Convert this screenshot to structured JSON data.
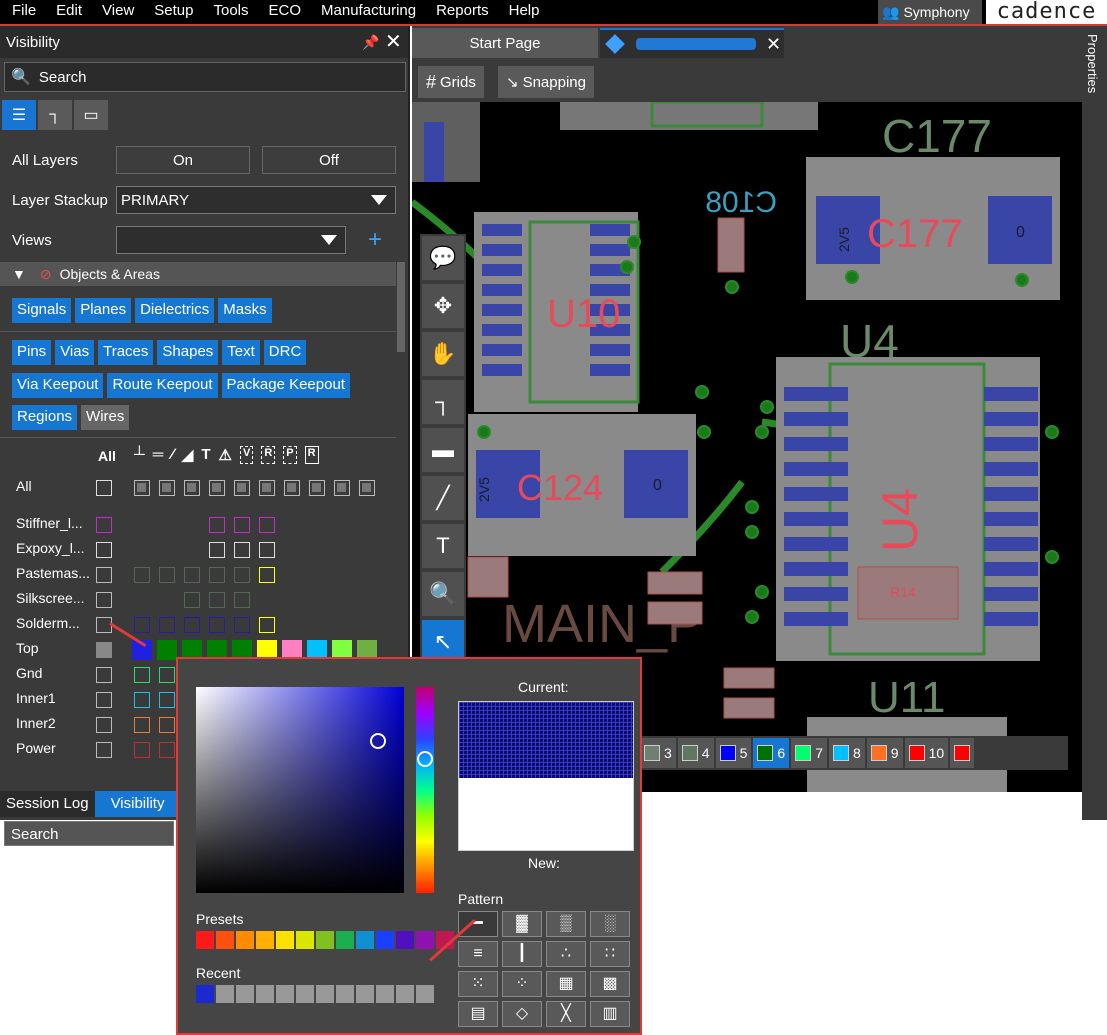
{
  "menubar": {
    "items": [
      "File",
      "Edit",
      "View",
      "Setup",
      "Tools",
      "ECO",
      "Manufacturing",
      "Reports",
      "Help"
    ],
    "symphony": "Symphony",
    "brand": "cadence"
  },
  "visibility": {
    "title": "Visibility",
    "search": "Search",
    "all_layers_label": "All Layers",
    "on_label": "On",
    "off_label": "Off",
    "stackup_label": "Layer Stackup",
    "stackup_value": "PRIMARY",
    "views_label": "Views",
    "views_value": "",
    "objects_header": "Objects & Areas",
    "chips_row1": [
      "Signals",
      "Planes",
      "Dielectrics",
      "Masks"
    ],
    "chips_row2": [
      "Pins",
      "Vias",
      "Traces",
      "Shapes",
      "Text",
      "DRC"
    ],
    "chips_row3": [
      "Via Keepout",
      "Route Keepout",
      "Package Keepout"
    ],
    "chips_row4": [
      "Regions",
      "Wires"
    ],
    "grid_all_header": "All",
    "grid_badges": [
      "V",
      "R",
      "P",
      "R"
    ],
    "layers": [
      "All",
      "Stiffner_l...",
      "Expoxy_l...",
      "Pastemas...",
      "Silkscree...",
      "Solderm...",
      "Top",
      "Gnd",
      "Inner1",
      "Inner2",
      "Power"
    ]
  },
  "bottom_tabs": {
    "session_log": "Session Log",
    "visibility": "Visibility",
    "search": "Search"
  },
  "doc_tabs": {
    "start": "Start Page",
    "design": ""
  },
  "toolbar": {
    "grids": "Grids",
    "snapping": "Snapping"
  },
  "properties": "Properties",
  "canvas_labels": {
    "c177": "C177",
    "u10": "U10",
    "u4": "U4",
    "c124": "C124",
    "u11": "U11",
    "main": "MAIN_P",
    "r14": "R14",
    "c108": "C108",
    "v2v5a": "2V5",
    "v2v5b": "2V5",
    "zero_a": "0",
    "zero_b": "0"
  },
  "layer_bar": [
    "3",
    "4",
    "5",
    "6",
    "7",
    "8",
    "9",
    "10"
  ],
  "layer_bar_colors": [
    "#708070",
    "#607860",
    "#0000ff",
    "#007000",
    "#00ff70",
    "#00c0ff",
    "#ff7020",
    "#ff0000",
    "#ff0000"
  ],
  "color_popup": {
    "current": "Current:",
    "new": "New:",
    "pattern": "Pattern",
    "presets": "Presets",
    "recent": "Recent",
    "preset_colors": [
      "#ff1a1a",
      "#ff5010",
      "#ff8c00",
      "#ffb000",
      "#ffe000",
      "#d8e600",
      "#80c020",
      "#1ab050",
      "#1090d0",
      "#1a40ff",
      "#5010c0",
      "#9010b0",
      "#c01850"
    ],
    "recent_colors": [
      "#1a2ad0",
      "#999",
      "#999",
      "#999",
      "#999",
      "#999",
      "#999",
      "#999",
      "#999",
      "#999",
      "#999",
      "#999"
    ]
  }
}
